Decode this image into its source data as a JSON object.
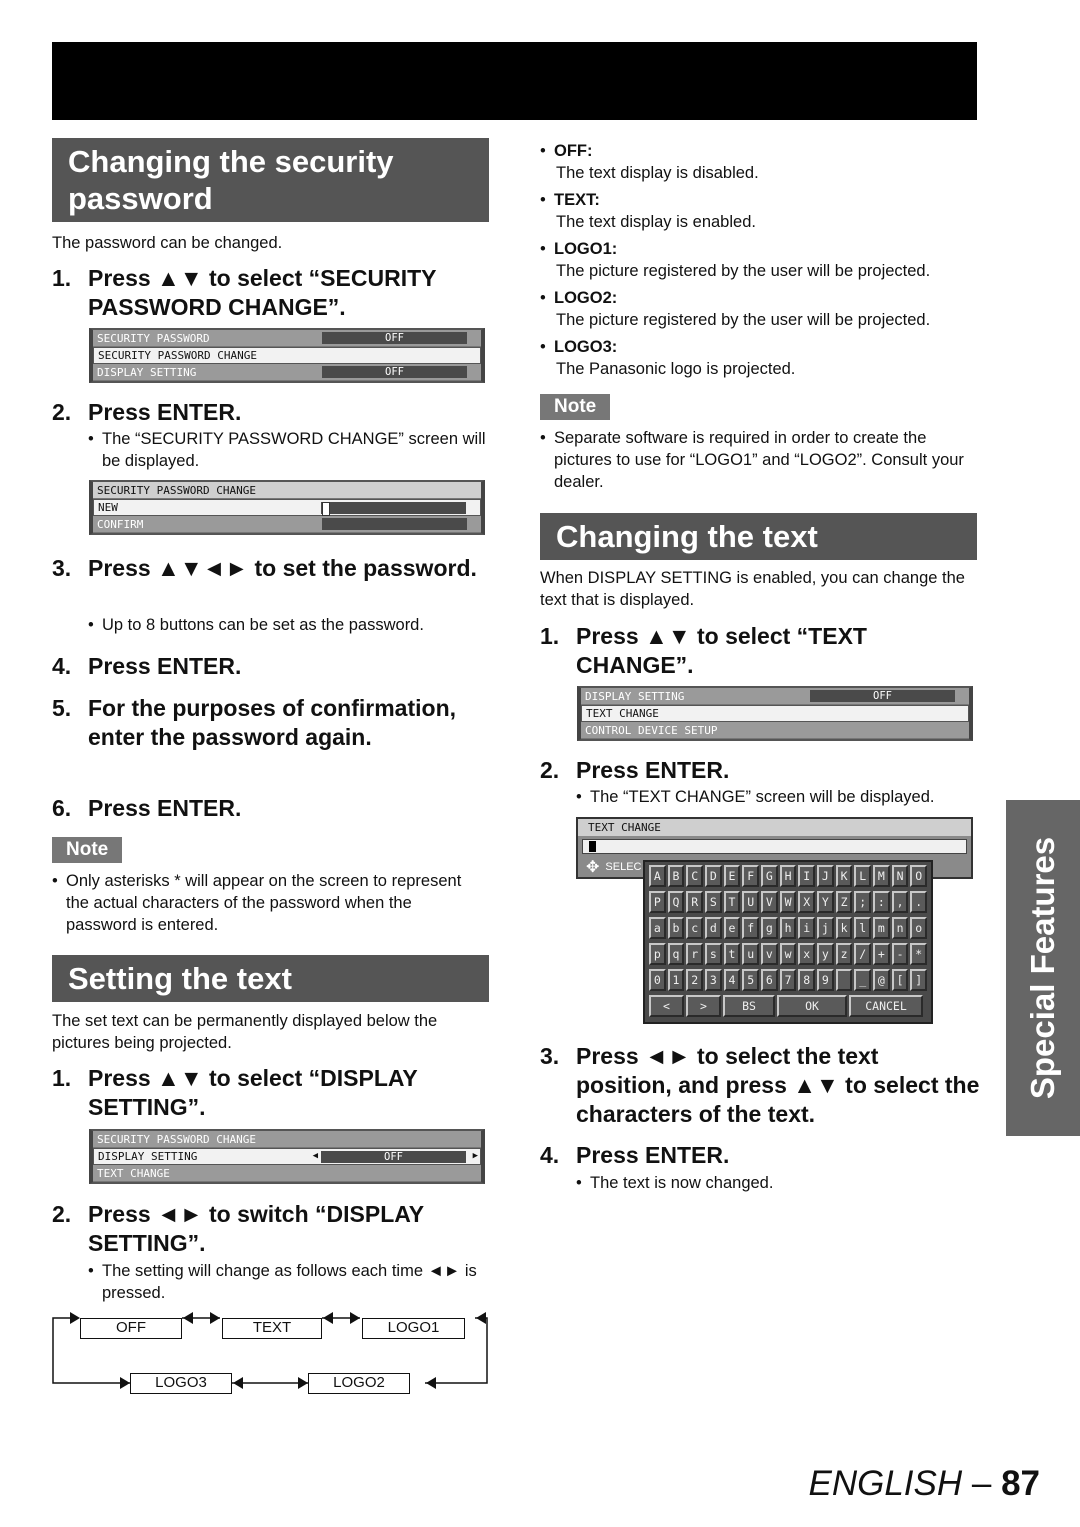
{
  "header_bar": "",
  "left": {
    "section1": {
      "title": "Changing the security password",
      "intro": "The password can be changed.",
      "step1": {
        "num": "1.",
        "text": "Press ▲▼ to select “SECURITY PASSWORD CHANGE”."
      },
      "menu1": {
        "rows": [
          {
            "label": "SECURITY PASSWORD",
            "value": "OFF"
          },
          {
            "label": "SECURITY PASSWORD CHANGE",
            "value": ""
          },
          {
            "label": "DISPLAY SETTING",
            "value": "OFF"
          }
        ]
      },
      "step2": {
        "num": "2.",
        "text": "Press ENTER."
      },
      "step2_bullet": "The “SECURITY PASSWORD CHANGE” screen will be displayed.",
      "menu2": {
        "title": "SECURITY PASSWORD CHANGE",
        "rows": [
          {
            "label": "NEW"
          },
          {
            "label": "CONFIRM"
          }
        ]
      },
      "step3": {
        "num": "3.",
        "text": "Press ▲▼◄► to set the password."
      },
      "step3_bullet": "Up to 8 buttons can be set as the password.",
      "step4": {
        "num": "4.",
        "text": "Press ENTER."
      },
      "step5": {
        "num": "5.",
        "text": "For the purposes of confirmation, enter the password again."
      },
      "step6": {
        "num": "6.",
        "text": "Press ENTER."
      },
      "note_label": "Note",
      "note_bullet": "Only asterisks * will appear on the screen to represent the actual characters of the password when the password is entered."
    },
    "section2": {
      "title": "Setting the text",
      "intro": "The set text can be permanently displayed below the pictures being projected.",
      "step1": {
        "num": "1.",
        "text": "Press ▲▼ to select “DISPLAY SETTING”."
      },
      "menu": {
        "rows": [
          {
            "label": "SECURITY PASSWORD CHANGE"
          },
          {
            "label": "DISPLAY SETTING",
            "value": "OFF"
          },
          {
            "label": "TEXT CHANGE"
          }
        ]
      },
      "step2": {
        "num": "2.",
        "text": "Press ◄► to switch “DISPLAY SETTING”."
      },
      "step2_bullet": "The setting will change as follows each time ◄► is pressed.",
      "flow": [
        "OFF",
        "TEXT",
        "LOGO1",
        "LOGO3",
        "LOGO2"
      ]
    }
  },
  "right": {
    "options": [
      {
        "label": "OFF:",
        "desc": "The text display is disabled."
      },
      {
        "label": "TEXT:",
        "desc": "The text display is enabled."
      },
      {
        "label": "LOGO1:",
        "desc": "The picture registered by the user will be projected."
      },
      {
        "label": "LOGO2:",
        "desc": "The picture registered by the user will be projected."
      },
      {
        "label": "LOGO3:",
        "desc": "The Panasonic logo is projected."
      }
    ],
    "note_label": "Note",
    "note_bullet": "Separate software is required in order to create the pictures to use for “LOGO1” and “LOGO2”. Consult your dealer.",
    "section3": {
      "title": "Changing the text",
      "intro": "When DISPLAY SETTING is enabled, you can change the text that is displayed.",
      "step1": {
        "num": "1.",
        "text": "Press ▲▼ to select “TEXT CHANGE”."
      },
      "menu": {
        "rows": [
          {
            "label": "DISPLAY SETTING",
            "value": "OFF"
          },
          {
            "label": "TEXT CHANGE"
          },
          {
            "label": "CONTROL DEVICE SETUP"
          }
        ]
      },
      "step2": {
        "num": "2.",
        "text": "Press ENTER."
      },
      "step2_bullet": "The “TEXT CHANGE” screen will be displayed.",
      "text_change_screen": {
        "title": "TEXT CHANGE",
        "select_label": "SELEC",
        "keyboard": [
          [
            "A",
            "B",
            "C",
            "D",
            "E",
            "F",
            "G",
            "H",
            "I",
            "J",
            "K",
            "L",
            "M",
            "N",
            "O"
          ],
          [
            "P",
            "Q",
            "R",
            "S",
            "T",
            "U",
            "V",
            "W",
            "X",
            "Y",
            "Z",
            ";",
            ":",
            ",",
            "."
          ],
          [
            "a",
            "b",
            "c",
            "d",
            "e",
            "f",
            "g",
            "h",
            "i",
            "j",
            "k",
            "l",
            "m",
            "n",
            "o"
          ],
          [
            "p",
            "q",
            "r",
            "s",
            "t",
            "u",
            "v",
            "w",
            "x",
            "y",
            "z",
            "/",
            "+",
            "-",
            "*"
          ],
          [
            "0",
            "1",
            "2",
            "3",
            "4",
            "5",
            "6",
            "7",
            "8",
            "9",
            " ",
            "_",
            "@",
            "[",
            "]"
          ]
        ],
        "buttons": [
          "<",
          ">",
          "BS",
          "OK",
          "CANCEL"
        ]
      },
      "step3": {
        "num": "3.",
        "text": "Press ◄► to select the text position, and press ▲▼ to select the characters of the text."
      },
      "step4": {
        "num": "4.",
        "text": "Press ENTER."
      },
      "step4_bullet": "The text is now changed."
    }
  },
  "side_tab": "Special Features",
  "footer": {
    "lang": "ENGLISH",
    "sep": " – ",
    "page": "87"
  }
}
